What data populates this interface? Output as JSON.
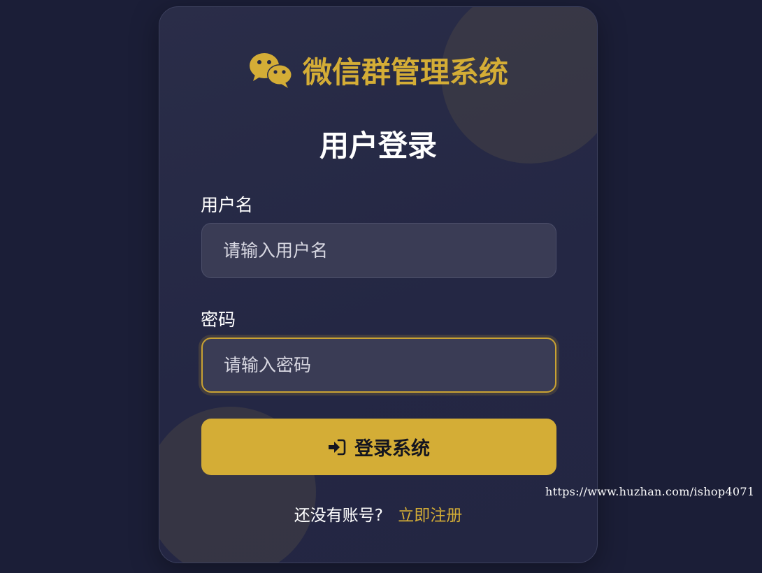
{
  "brand": {
    "title": "微信群管理系统",
    "icon": "wechat-icon",
    "accent_color": "#d4ad36"
  },
  "login": {
    "title": "用户登录",
    "username": {
      "label": "用户名",
      "placeholder": "请输入用户名",
      "value": ""
    },
    "password": {
      "label": "密码",
      "placeholder": "请输入密码",
      "value": ""
    },
    "submit": {
      "label": "登录系统",
      "icon": "sign-in-icon"
    },
    "register": {
      "prompt": "还没有账号?",
      "link_label": "立即注册"
    }
  },
  "watermark": {
    "text": "https://www.huzhan.com/ishop4071"
  },
  "colors": {
    "background": "#1b1e37",
    "card": "#262944",
    "input": "#3a3c55",
    "button": "#d4ad36"
  }
}
